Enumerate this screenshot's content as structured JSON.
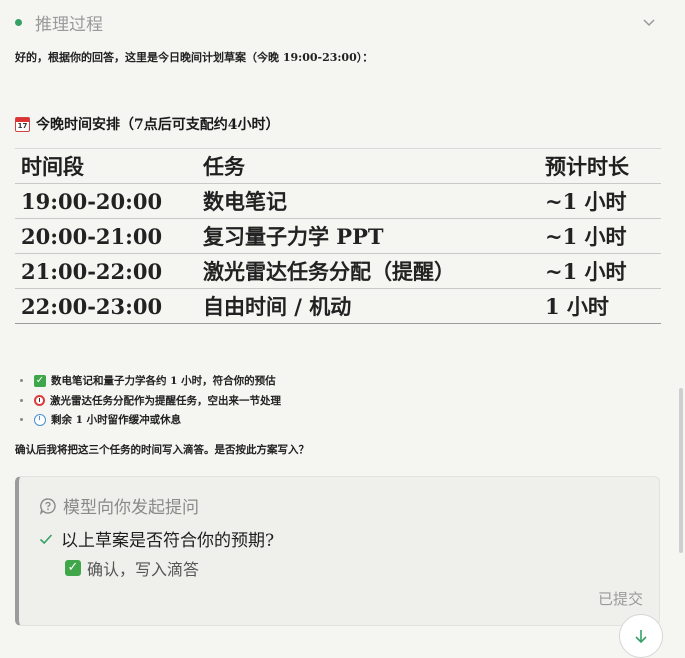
{
  "reasoning": {
    "title": "推理过程"
  },
  "intro": "好的，根据你的回答，这里是今日晚间计划草案（今晚 19:00-23:00）：",
  "schedule": {
    "heading": "今晚时间安排（7点后可支配约4小时）",
    "calendar_day": "17",
    "columns": [
      "时间段",
      "任务",
      "预计时长"
    ],
    "rows": [
      [
        "19:00-20:00",
        "数电笔记",
        "~1 小时"
      ],
      [
        "20:00-21:00",
        "复习量子力学 PPT",
        "~1 小时"
      ],
      [
        "21:00-22:00",
        "激光雷达任务分配（提醒）",
        "~1 小时"
      ],
      [
        "22:00-23:00",
        "自由时间 / 机动",
        "1 小时"
      ]
    ]
  },
  "notes": [
    {
      "icon": "check-mark-emoji-icon",
      "text": "数电笔记和量子力学各约 1 小时，符合你的预估"
    },
    {
      "icon": "alarm-clock-icon",
      "text": "激光雷达任务分配作为提醒任务，空出来一节处理"
    },
    {
      "icon": "clock-icon",
      "text": "剩余 1 小时留作缓冲或休息"
    }
  ],
  "confirm_question": "确认后我将把这三个任务的时间写入滴答。是否按此方案写入？",
  "prompt_card": {
    "header": "模型向你发起提问",
    "question": "以上草案是否符合你的预期?",
    "answer": "确认，写入滴答",
    "status": "已提交"
  },
  "colors": {
    "accent_green": "#36a066",
    "background": "#f5f5f2",
    "card_border": "#9c9c9c"
  }
}
